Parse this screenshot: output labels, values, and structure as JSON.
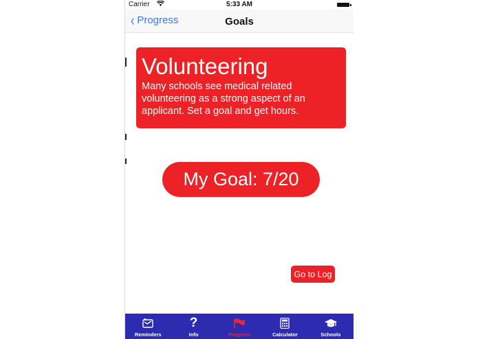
{
  "status_bar": {
    "carrier": "Carrier",
    "time": "5:33 AM"
  },
  "nav": {
    "back_label": "Progress",
    "title": "Goals"
  },
  "card": {
    "title": "Volunteering",
    "description": "Many schools see medical related volunteering as a strong aspect of an applicant. Set a goal and get hours."
  },
  "goal": {
    "label": "My Goal: 7/20"
  },
  "log_button": {
    "label": "Go to Log"
  },
  "tabs": [
    {
      "label": "Reminders",
      "icon": "reminders-icon",
      "active": false
    },
    {
      "label": "Info",
      "icon": "question-icon",
      "active": false
    },
    {
      "label": "Progress",
      "icon": "flag-icon",
      "active": true
    },
    {
      "label": "Calculator",
      "icon": "calculator-icon",
      "active": false
    },
    {
      "label": "Schools",
      "icon": "graduation-cap-icon",
      "active": false
    }
  ],
  "colors": {
    "accent_red": "#ec2227",
    "tab_bar_blue": "#2d2bb0",
    "link_blue": "#3478f6",
    "active_tab": "#e8253a"
  }
}
